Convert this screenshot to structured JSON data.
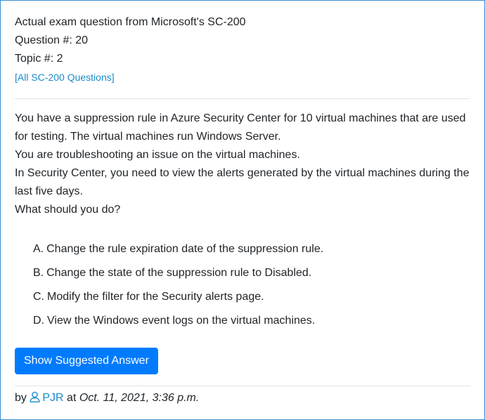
{
  "header": {
    "title": "Actual exam question from Microsoft's SC-200",
    "question_number": "Question #: 20",
    "topic": "Topic #: 2",
    "all_questions_link": "[All SC-200 Questions]"
  },
  "question": {
    "lines": [
      "You have a suppression rule in Azure Security Center for 10 virtual machines that are used for testing. The virtual machines run Windows Server.",
      "You are troubleshooting an issue on the virtual machines.",
      "In Security Center, you need to view the alerts generated by the virtual machines during the last five days.",
      "What should you do?"
    ]
  },
  "choices": [
    {
      "letter": "A.",
      "text": "Change the rule expiration date of the suppression rule."
    },
    {
      "letter": "B.",
      "text": "Change the state of the suppression rule to Disabled."
    },
    {
      "letter": "C.",
      "text": "Modify the filter for the Security alerts page."
    },
    {
      "letter": "D.",
      "text": "View the Windows event logs on the virtual machines."
    }
  ],
  "actions": {
    "show_answer_label": "Show Suggested Answer"
  },
  "meta": {
    "by_label": "by",
    "user_icon": "user-icon",
    "author": "PJR",
    "at_label": "at",
    "date": "Oct. 11, 2021, 3:36 p.m."
  },
  "colors": {
    "link": "#1a8acb",
    "button": "#007bff",
    "border": "#3a8fd6"
  }
}
